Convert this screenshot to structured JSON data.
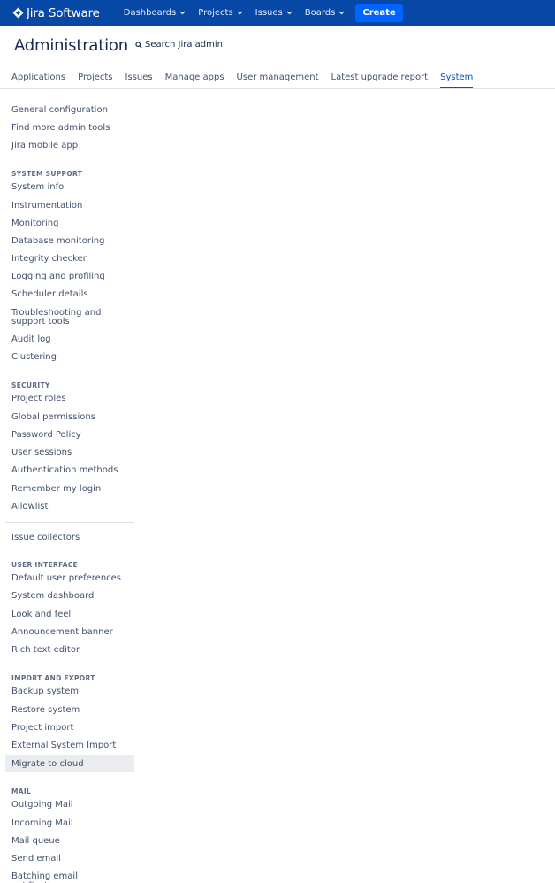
{
  "topnav": {
    "logo_text": "Jira Software",
    "items": [
      {
        "label": "Dashboards"
      },
      {
        "label": "Projects"
      },
      {
        "label": "Issues"
      },
      {
        "label": "Boards"
      }
    ],
    "create_label": "Create",
    "colors": {
      "bar": "#0747a6",
      "create": "#0065ff"
    }
  },
  "header": {
    "title": "Administration",
    "search_label": "Search Jira admin"
  },
  "tabs": [
    {
      "label": "Applications"
    },
    {
      "label": "Projects"
    },
    {
      "label": "Issues"
    },
    {
      "label": "Manage apps"
    },
    {
      "label": "User management"
    },
    {
      "label": "Latest upgrade report"
    },
    {
      "label": "System",
      "active": true
    }
  ],
  "sidebar": {
    "general": [
      "General configuration",
      "Find more admin tools",
      "Jira mobile app"
    ],
    "system_support": {
      "heading": "SYSTEM SUPPORT",
      "items": [
        "System info",
        "Instrumentation",
        "Monitoring",
        "Database monitoring",
        "Integrity checker",
        "Logging and profiling",
        "Scheduler details",
        "Troubleshooting and",
        "support tools",
        "Audit log",
        "Clustering"
      ]
    },
    "security": {
      "heading": "SECURITY",
      "items": [
        "Project roles",
        "Global permissions",
        "Password Policy",
        "User sessions",
        "Authentication methods",
        "Remember my login",
        "Allowlist"
      ]
    },
    "issue_collectors": "Issue collectors",
    "user_interface": {
      "heading": "USER INTERFACE",
      "items": [
        "Default user preferences",
        "System dashboard",
        "Look and feel",
        "Announcement banner",
        "Rich text editor"
      ]
    },
    "import_export": {
      "heading": "IMPORT AND EXPORT",
      "items": [
        "Backup system",
        "Restore system",
        "Project import",
        "External System Import",
        "Migrate to cloud"
      ]
    },
    "mail": {
      "heading": "MAIL",
      "items": [
        "Outgoing Mail",
        "Incoming Mail",
        "Mail queue",
        "Send email",
        "Batching email notifications"
      ]
    }
  }
}
